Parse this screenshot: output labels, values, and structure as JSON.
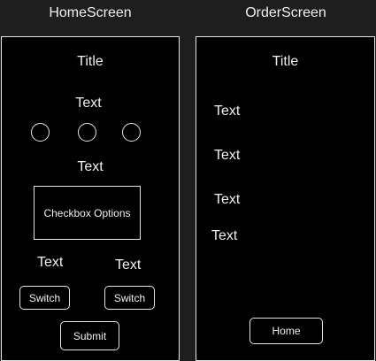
{
  "home_screen": {
    "label": "HomeScreen",
    "title": "Title",
    "text_1": "Text",
    "radio_count": 3,
    "text_2": "Text",
    "checkbox_options": "Checkbox Options",
    "text_left": "Text",
    "text_right": "Text",
    "switch_left": "Switch",
    "switch_right": "Switch",
    "submit": "Submit"
  },
  "order_screen": {
    "label": "OrderScreen",
    "title": "Title",
    "texts": [
      "Text",
      "Text",
      "Text",
      "Text"
    ],
    "home_button": "Home"
  }
}
